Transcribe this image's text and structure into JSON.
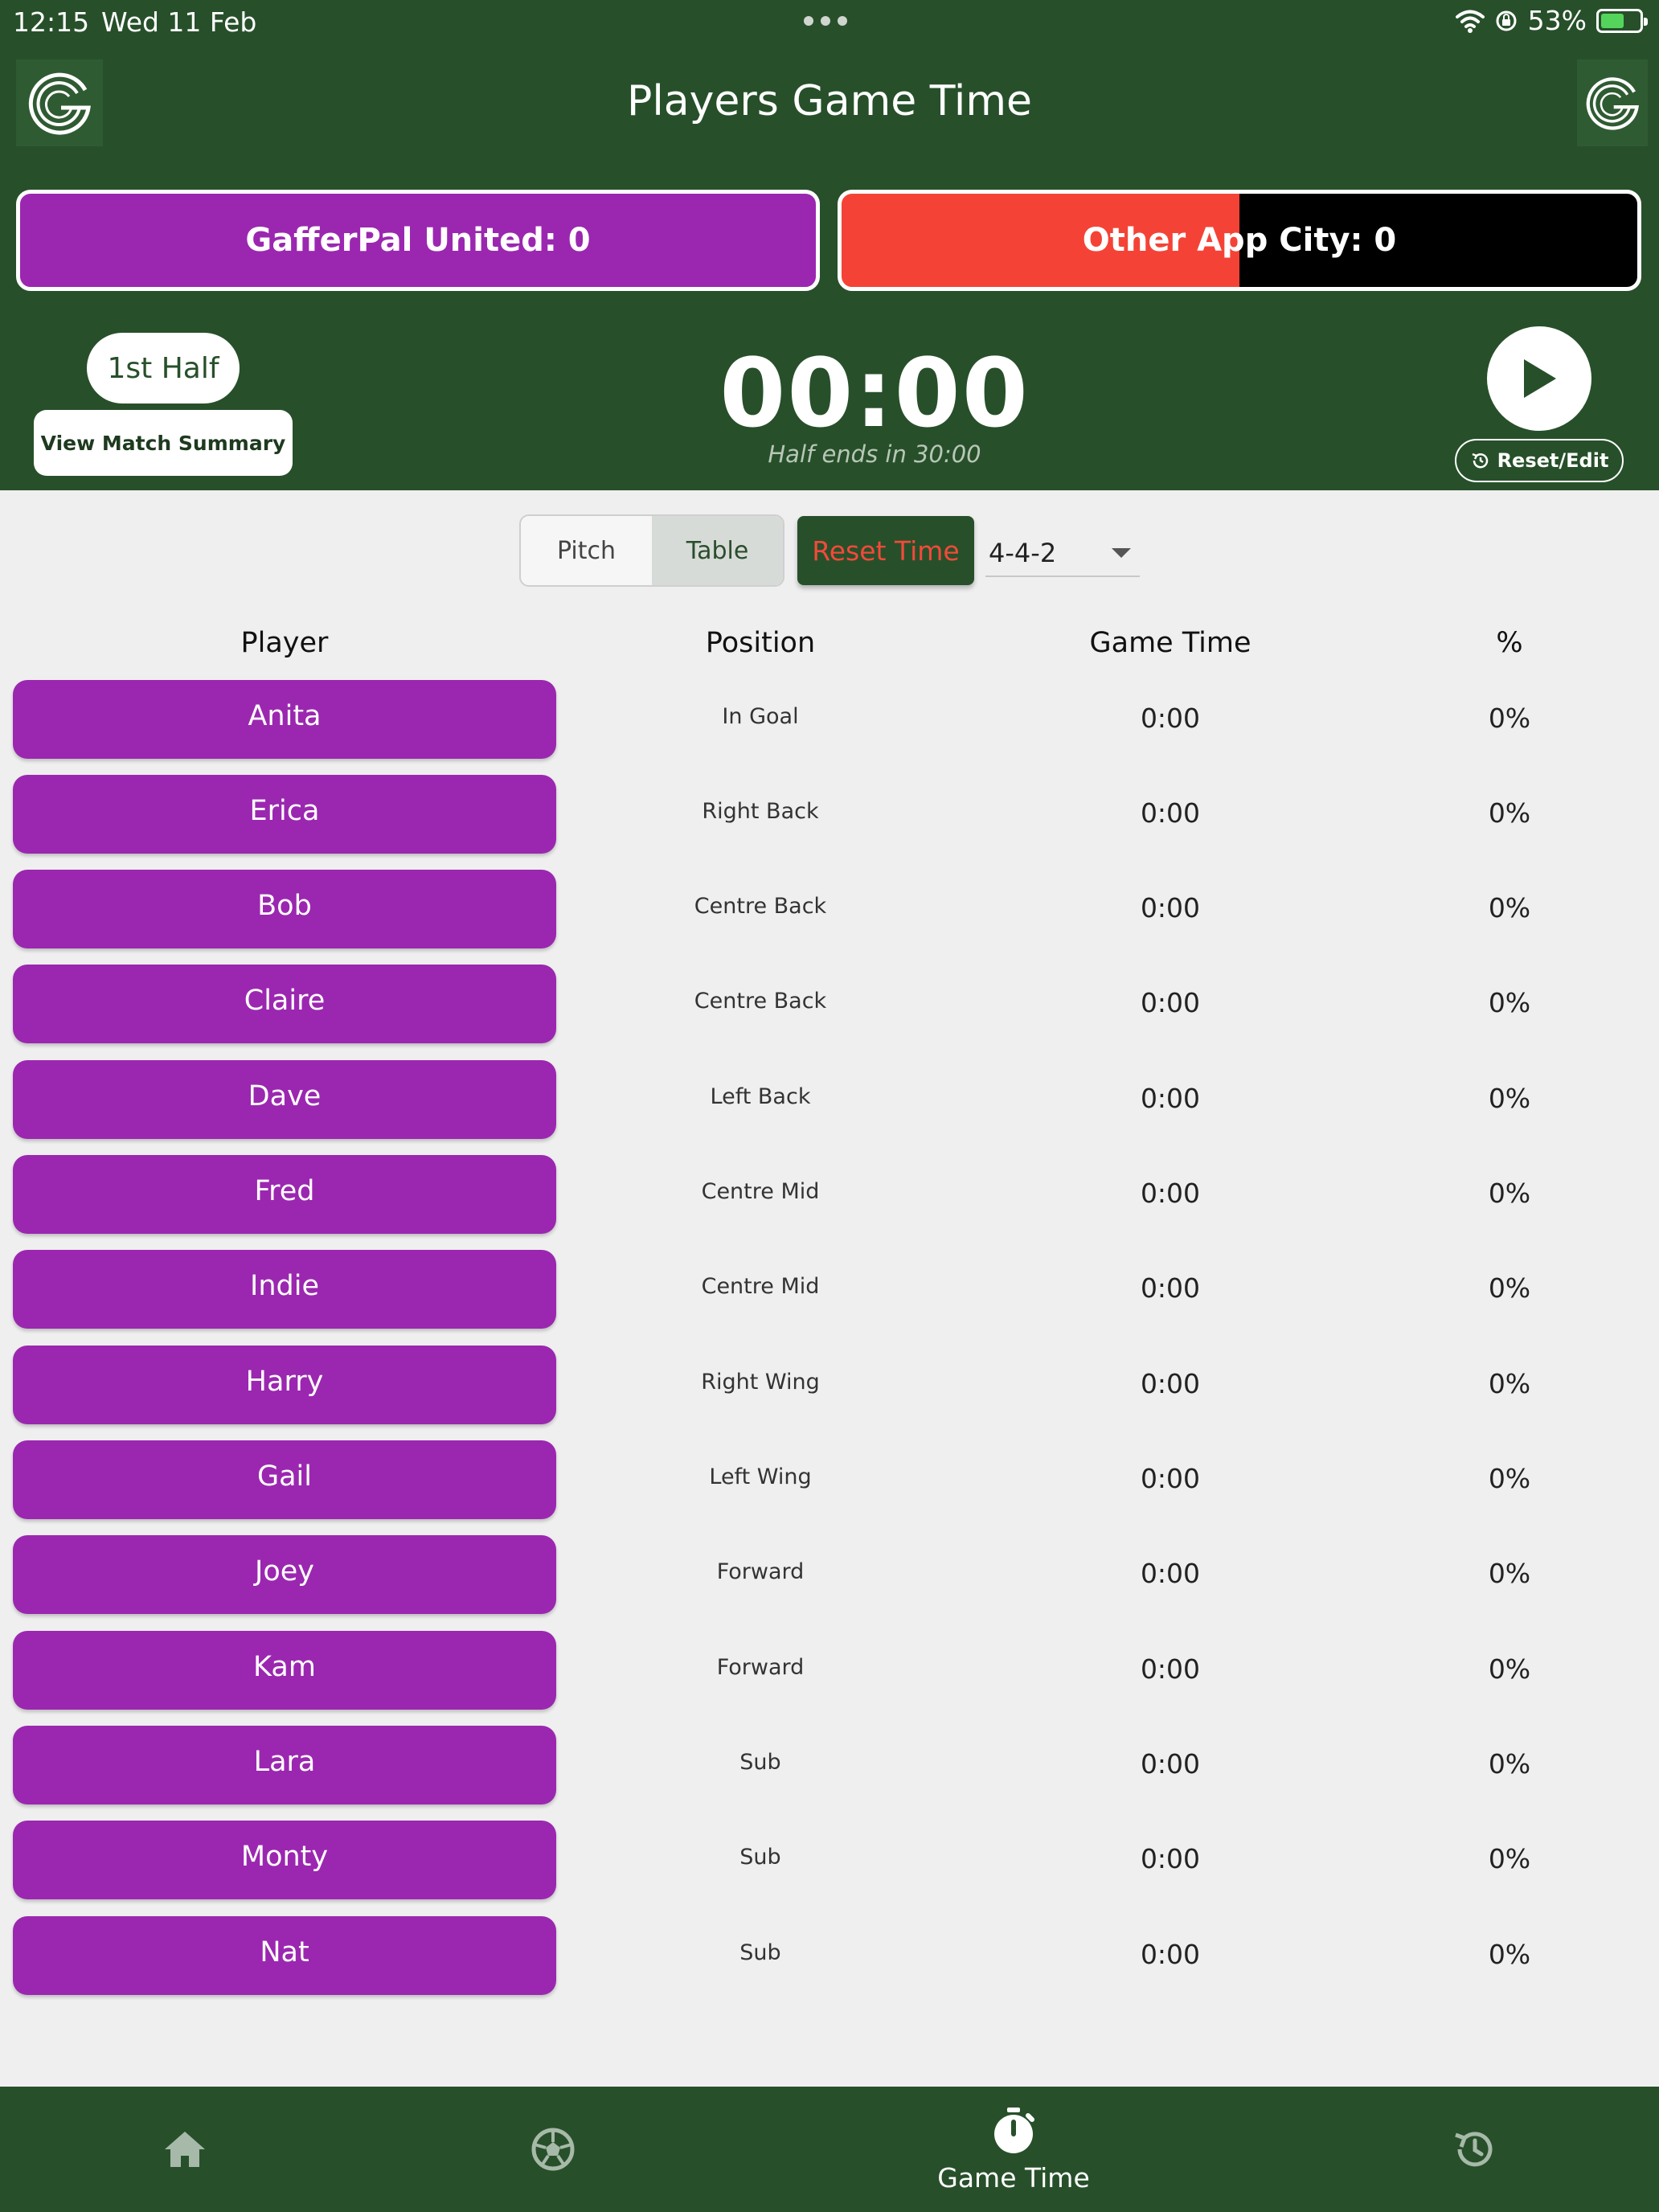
{
  "status_bar": {
    "time": "12:15",
    "date": "Wed 11 Feb",
    "battery": "53%"
  },
  "header": {
    "title": "Players Game Time",
    "home_team_score": "GafferPal United: 0",
    "away_team_score": "Other App City: 0",
    "half": "1st Half",
    "view_summary": "View Match Summary",
    "clock": "00:00",
    "half_ends": "Half ends in 30:00",
    "reset_edit": "Reset/Edit"
  },
  "controls": {
    "view_pitch": "Pitch",
    "view_table": "Table",
    "reset_time": "Reset Time",
    "formation": "4-4-2"
  },
  "table": {
    "columns": [
      "Player",
      "Position",
      "Game Time",
      "%"
    ],
    "rows": [
      {
        "player": "Anita",
        "position": "In Goal",
        "time": "0:00",
        "pct": "0%"
      },
      {
        "player": "Erica",
        "position": "Right Back",
        "time": "0:00",
        "pct": "0%"
      },
      {
        "player": "Bob",
        "position": "Centre Back",
        "time": "0:00",
        "pct": "0%"
      },
      {
        "player": "Claire",
        "position": "Centre Back",
        "time": "0:00",
        "pct": "0%"
      },
      {
        "player": "Dave",
        "position": "Left Back",
        "time": "0:00",
        "pct": "0%"
      },
      {
        "player": "Fred",
        "position": "Centre Mid",
        "time": "0:00",
        "pct": "0%"
      },
      {
        "player": "Indie",
        "position": "Centre Mid",
        "time": "0:00",
        "pct": "0%"
      },
      {
        "player": "Harry",
        "position": "Right Wing",
        "time": "0:00",
        "pct": "0%"
      },
      {
        "player": "Gail",
        "position": "Left Wing",
        "time": "0:00",
        "pct": "0%"
      },
      {
        "player": "Joey",
        "position": "Forward",
        "time": "0:00",
        "pct": "0%"
      },
      {
        "player": "Kam",
        "position": "Forward",
        "time": "0:00",
        "pct": "0%"
      },
      {
        "player": "Lara",
        "position": "Sub",
        "time": "0:00",
        "pct": "0%"
      },
      {
        "player": "Monty",
        "position": "Sub",
        "time": "0:00",
        "pct": "0%"
      },
      {
        "player": "Nat",
        "position": "Sub",
        "time": "0:00",
        "pct": "0%"
      }
    ]
  },
  "bottom_nav": {
    "items": [
      {
        "icon": "home-icon"
      },
      {
        "icon": "football-icon"
      },
      {
        "icon": "stopwatch-icon",
        "label": "Game Time",
        "active": true
      },
      {
        "icon": "history-icon"
      }
    ]
  },
  "colors": {
    "header_green": "#27502a",
    "player_purple": "#9b27b0",
    "away_red": "#f44336",
    "away_black": "#000000",
    "reset_red": "#f24a3a",
    "background": "#efefef"
  }
}
